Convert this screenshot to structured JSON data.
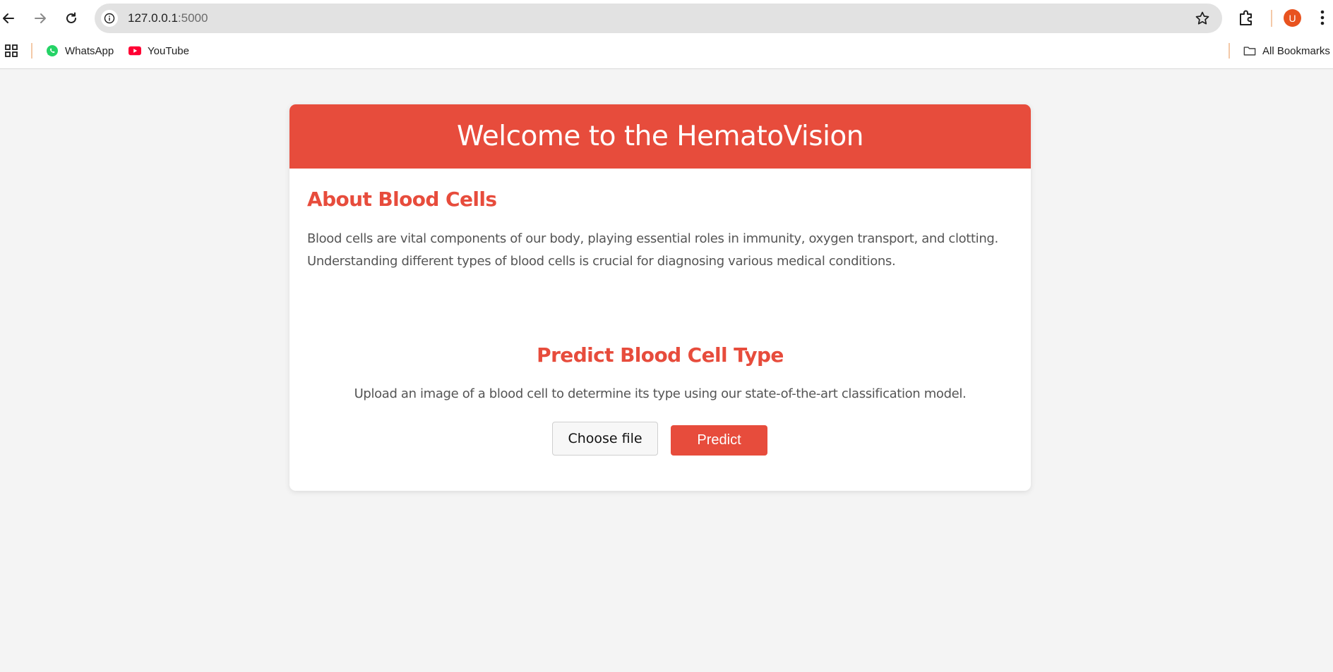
{
  "browser": {
    "url_host": "127.0.0.1",
    "url_port": ":5000",
    "bookmarks": [
      {
        "label": "WhatsApp",
        "icon": "whatsapp-icon"
      },
      {
        "label": "YouTube",
        "icon": "youtube-icon"
      }
    ],
    "all_bookmarks_label": "All Bookmarks",
    "avatar_letter": "U"
  },
  "page": {
    "header_title": "Welcome to the HematoVision",
    "about_title": "About Blood Cells",
    "about_text": "Blood cells are vital components of our body, playing essential roles in immunity, oxygen transport, and clotting. Understanding different types of blood cells is crucial for diagnosing various medical conditions.",
    "predict_title": "Predict Blood Cell Type",
    "predict_text": "Upload an image of a blood cell to determine its type using our state-of-the-art classification model.",
    "choose_file_label": "Choose file",
    "predict_label": "Predict"
  },
  "colors": {
    "accent": "#e74c3c",
    "page_bg": "#f4f4f4",
    "body_text": "#555555"
  }
}
